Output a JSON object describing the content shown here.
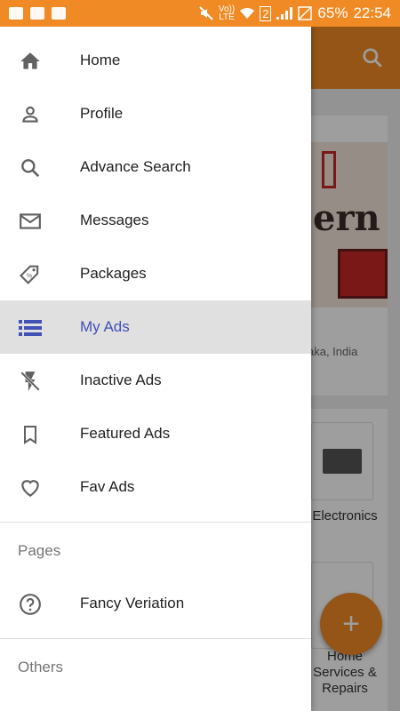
{
  "status_bar": {
    "volte_top": "Vo))",
    "volte_bottom": "LTE",
    "sim": "2",
    "battery": "65%",
    "time": "22:54"
  },
  "background": {
    "banner_word": "ern",
    "location": "aka, India",
    "categories": [
      {
        "label": "Electronics"
      },
      {
        "label": "Home Services & Repairs"
      }
    ],
    "fab_label": "+"
  },
  "drawer": {
    "items": [
      {
        "label": "Home",
        "icon": "home-icon"
      },
      {
        "label": "Profile",
        "icon": "person-icon"
      },
      {
        "label": "Advance Search",
        "icon": "search-icon"
      },
      {
        "label": "Messages",
        "icon": "mail-icon"
      },
      {
        "label": "Packages",
        "icon": "tag-icon"
      },
      {
        "label": "My Ads",
        "icon": "list-icon",
        "active": true
      },
      {
        "label": "Inactive Ads",
        "icon": "flash-off-icon"
      },
      {
        "label": "Featured Ads",
        "icon": "bookmark-icon"
      },
      {
        "label": "Fav Ads",
        "icon": "heart-icon"
      }
    ],
    "section_pages": "Pages",
    "pages_items": [
      {
        "label": "Fancy Veriation",
        "icon": "help-circle-icon"
      }
    ],
    "section_others": "Others"
  },
  "colors": {
    "accent": "#f08a24",
    "active_text": "#3f51b5",
    "active_bg": "#e0e0e0"
  }
}
